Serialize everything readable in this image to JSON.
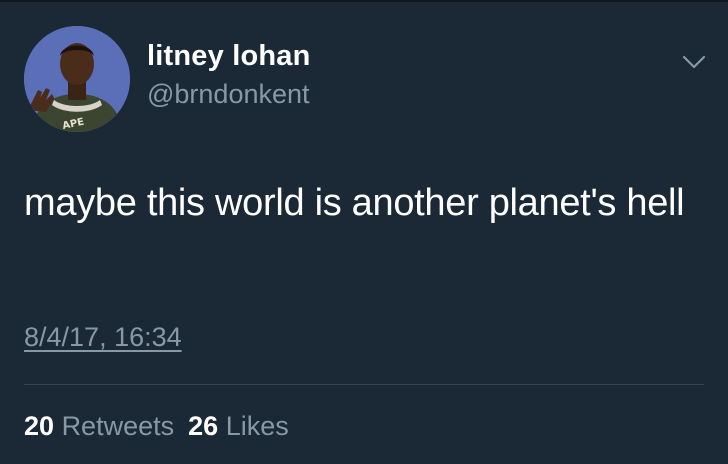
{
  "tweet": {
    "author": {
      "display_name": "litney lohan",
      "handle": "@brndonkent",
      "avatar_icon": "profile-photo"
    },
    "menu_icon": "chevron-down-icon",
    "text": "maybe this world is another planet's hell",
    "timestamp": "8/4/17, 16:34",
    "stats": {
      "retweets_count": "20",
      "retweets_label": "Retweets",
      "likes_count": "26",
      "likes_label": "Likes"
    }
  },
  "colors": {
    "background": "#1b2836",
    "primary_text": "#ffffff",
    "secondary_text": "#8899a6",
    "divider": "#38444d"
  }
}
